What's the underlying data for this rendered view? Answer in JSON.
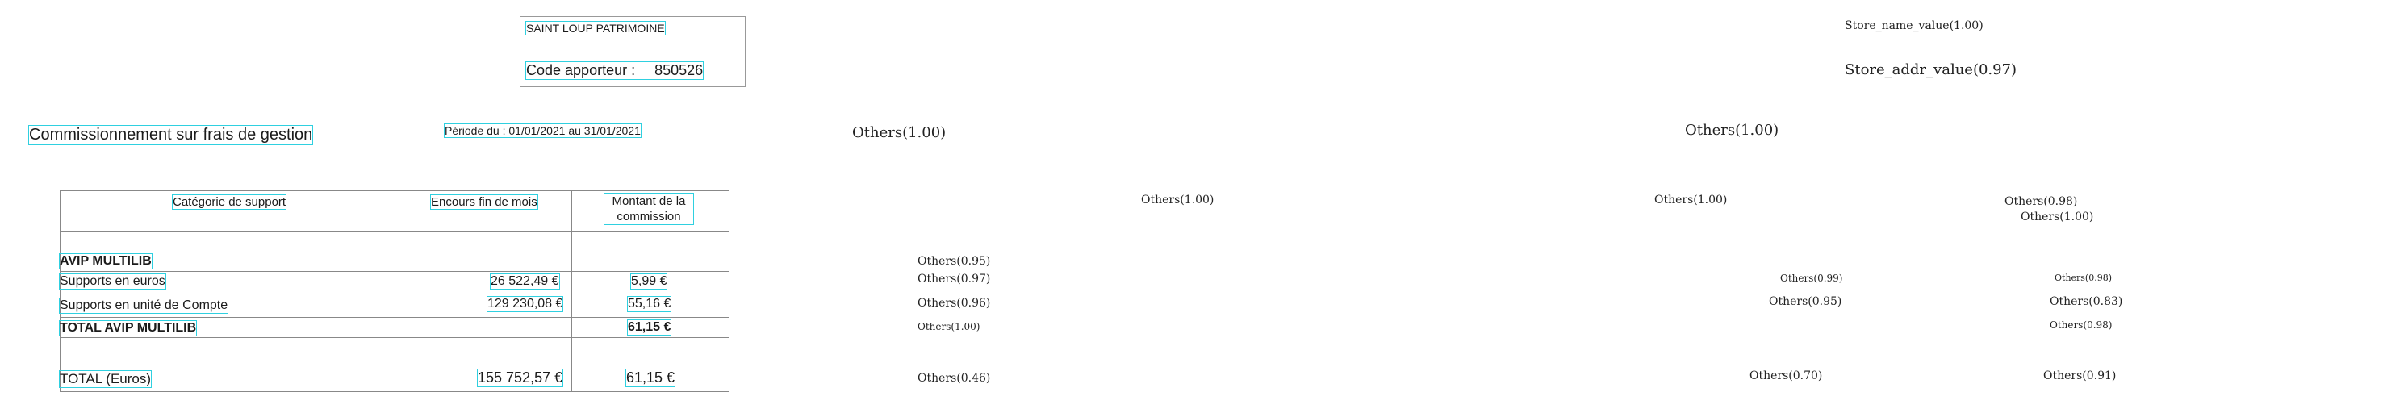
{
  "header": {
    "store_name": "SAINT LOUP PATRIMOINE",
    "code_label": "Code apporteur :",
    "code_value": "850526"
  },
  "title": "Commissionnement sur frais de gestion",
  "periode": "Période du :  01/01/2021  au  31/01/2021",
  "table": {
    "headers": [
      "Catégorie de support",
      "Encours fin de mois",
      "Montant de la commission"
    ],
    "rows": [
      {
        "label": "AVIP MULTILIB",
        "encours": "",
        "montant": ""
      },
      {
        "label": "Supports en euros",
        "encours": "26 522,49 €",
        "montant": "5,99 €"
      },
      {
        "label": "Supports en unité de Compte",
        "encours": "129 230,08 €",
        "montant": "55,16 €"
      },
      {
        "label": "TOTAL AVIP MULTILIB",
        "encours": "",
        "montant": "61,15 €"
      },
      {
        "label": "TOTAL (Euros)",
        "encours": "155 752,57 €",
        "montant": "61,15 €"
      }
    ]
  },
  "annotations": {
    "store_name": "Store_name_value(1.00)",
    "store_addr": "Store_addr_value(0.97)",
    "title_a": "Others(1.00)",
    "title_b": "Others(1.00)",
    "hdr_a": "Others(1.00)",
    "hdr_b": "Others(1.00)",
    "hdr_c": "Others(0.98)",
    "hdr_c2": "Others(1.00)",
    "avip": "Others(0.95)",
    "euros_a": "Others(0.97)",
    "euros_b": "Others(0.99)",
    "euros_c": "Others(0.98)",
    "uc_a": "Others(0.96)",
    "uc_b": "Others(0.95)",
    "uc_c": "Others(0.83)",
    "totavip_a": "Others(1.00)",
    "totavip_c": "Others(0.98)",
    "total_a": "Others(0.46)",
    "total_b": "Others(0.70)",
    "total_c": "Others(0.91)"
  }
}
